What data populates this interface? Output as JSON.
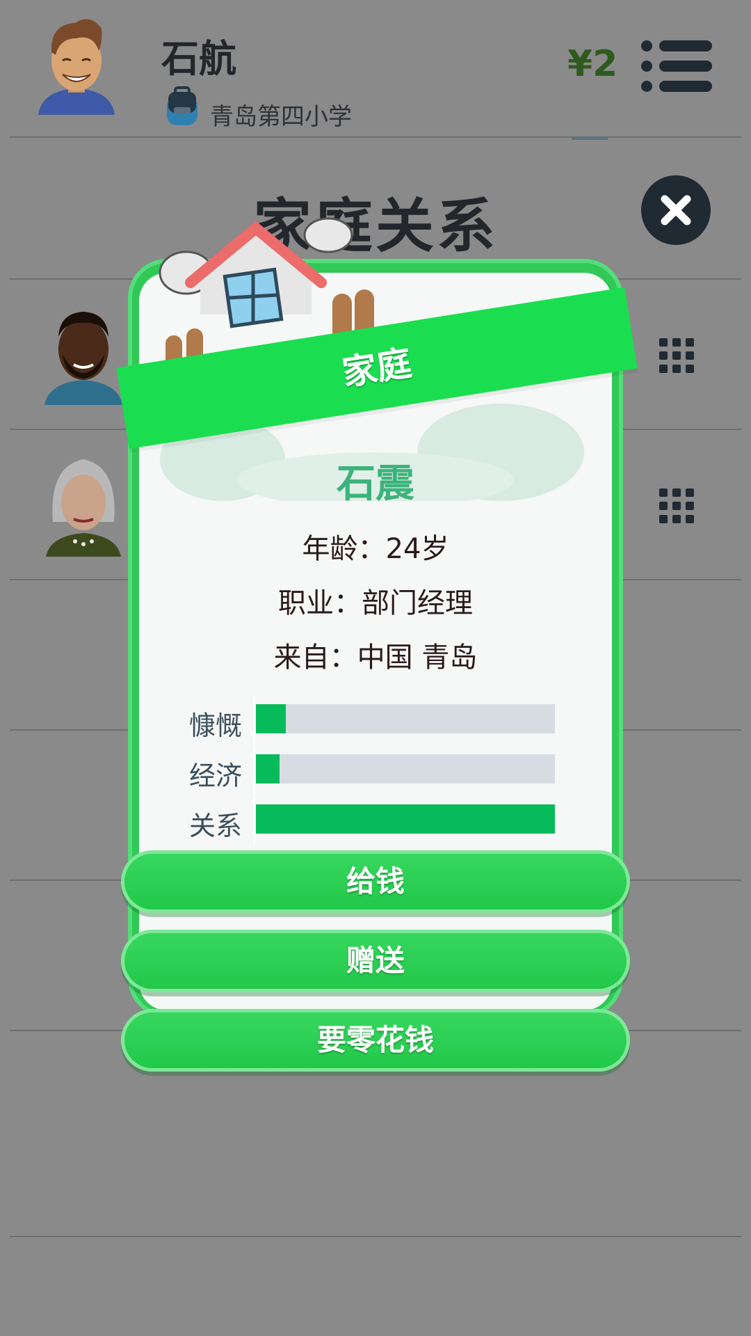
{
  "header": {
    "user_name": "石航",
    "school_name": "青岛第四小学",
    "money": "¥2",
    "avatar_icon": "boy-avatar-icon",
    "school_icon": "backpack-icon",
    "menu_icon": "list-menu-icon"
  },
  "section": {
    "title": "家庭关系",
    "close_icon": "close-icon"
  },
  "members_icons": [
    "father-avatar-icon",
    "grandmother-avatar-icon"
  ],
  "modal": {
    "banner": "家庭",
    "name": "石震",
    "age": "年龄：24岁",
    "job": "职业：部门经理",
    "origin": "来自：中国 青岛",
    "stats": [
      {
        "label": "慷慨",
        "value": 0.1
      },
      {
        "label": "经济",
        "value": 0.08
      },
      {
        "label": "关系",
        "value": 1.0
      }
    ],
    "buttons": [
      "给钱",
      "赠送",
      "要零花钱"
    ]
  },
  "colors": {
    "accent_green": "#30c957",
    "stat_fill": "#08bb5a",
    "name_color": "#3cb37a",
    "dark": "#1f2a33"
  }
}
